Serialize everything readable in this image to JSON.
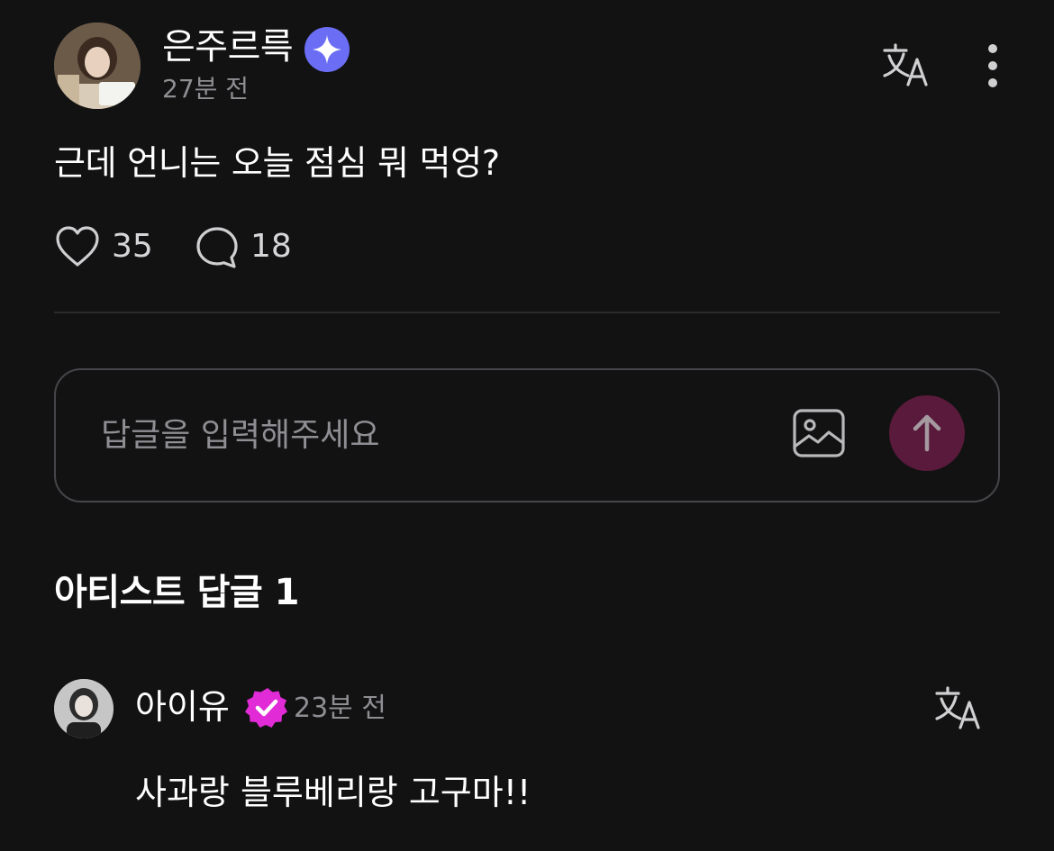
{
  "post": {
    "author_name": "은주르륵",
    "author_badge_icon": "sparkle-star-icon",
    "author_badge_color": "#6b6ef5",
    "time": "27분 전",
    "body": "근데 언니는 오늘 점심 뭐 먹엉?",
    "likes": "35",
    "replies": "18"
  },
  "reply_input": {
    "placeholder": "답글을 입력해주세요",
    "value": "",
    "send_button_color": "#5a1a3b"
  },
  "artist_section": {
    "title": "아티스트 답글 1"
  },
  "artist_reply": {
    "name": "아이유",
    "badge_icon": "verified-check-icon",
    "badge_color": "#e02bd6",
    "time": "23분 전",
    "body": "사과랑 블루베리랑 고구마!!"
  },
  "colors": {
    "background": "#121213",
    "text_primary": "#ffffff",
    "text_secondary": "#8e8e93",
    "divider": "#2b2b2e"
  }
}
